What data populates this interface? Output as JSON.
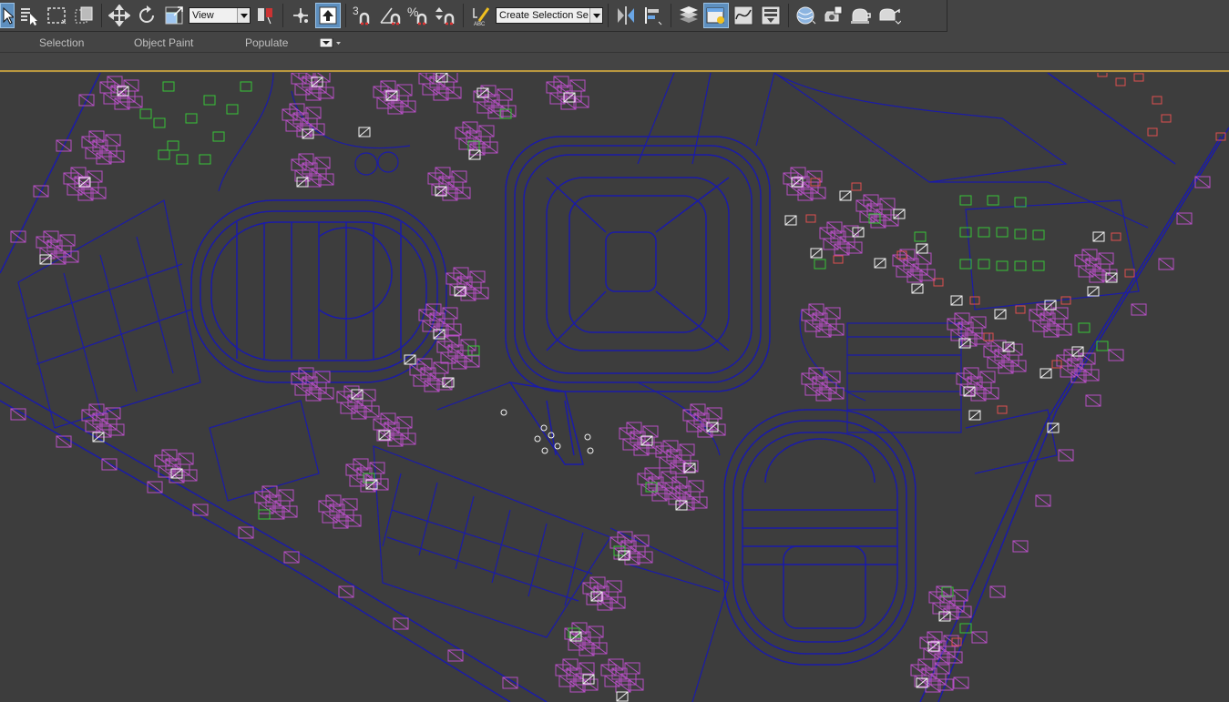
{
  "toolbar": {
    "view_dropdown": "View",
    "selection_set_dropdown": "Create Selection Se",
    "snap_toggle_label": "3",
    "percent_snap_label": "%"
  },
  "ribbon": {
    "tabs": [
      {
        "label": "Selection"
      },
      {
        "label": "Object Paint"
      },
      {
        "label": "Populate"
      }
    ]
  },
  "colors": {
    "toolbar_bg": "#444444",
    "viewport_bg": "#3d3d3d",
    "active_button": "#5d8fbf",
    "cad_lines": "#1b1ba8",
    "trees_purple": "#b64fc4",
    "trees_green": "#36c536",
    "accent_red": "#e05050",
    "ribbon_underline": "#b9973f"
  },
  "icons": [
    "select-object-icon",
    "select-by-name-icon",
    "rect-selection-region-icon",
    "window-crossing-icon",
    "select-move-icon",
    "select-rotate-icon",
    "select-scale-icon",
    "pivot-center-icon",
    "manipulate-icon",
    "keyboard-shortcut-icon",
    "snaps-toggle-icon",
    "angle-snap-icon",
    "percent-snap-icon",
    "spinner-snap-icon",
    "edit-named-selection-icon",
    "mirror-icon",
    "align-icon",
    "layer-explorer-icon",
    "scene-explorer-icon",
    "curve-editor-icon",
    "schematic-view-icon",
    "material-editor-icon",
    "render-setup-icon",
    "rendered-frame-icon",
    "render-icon"
  ]
}
